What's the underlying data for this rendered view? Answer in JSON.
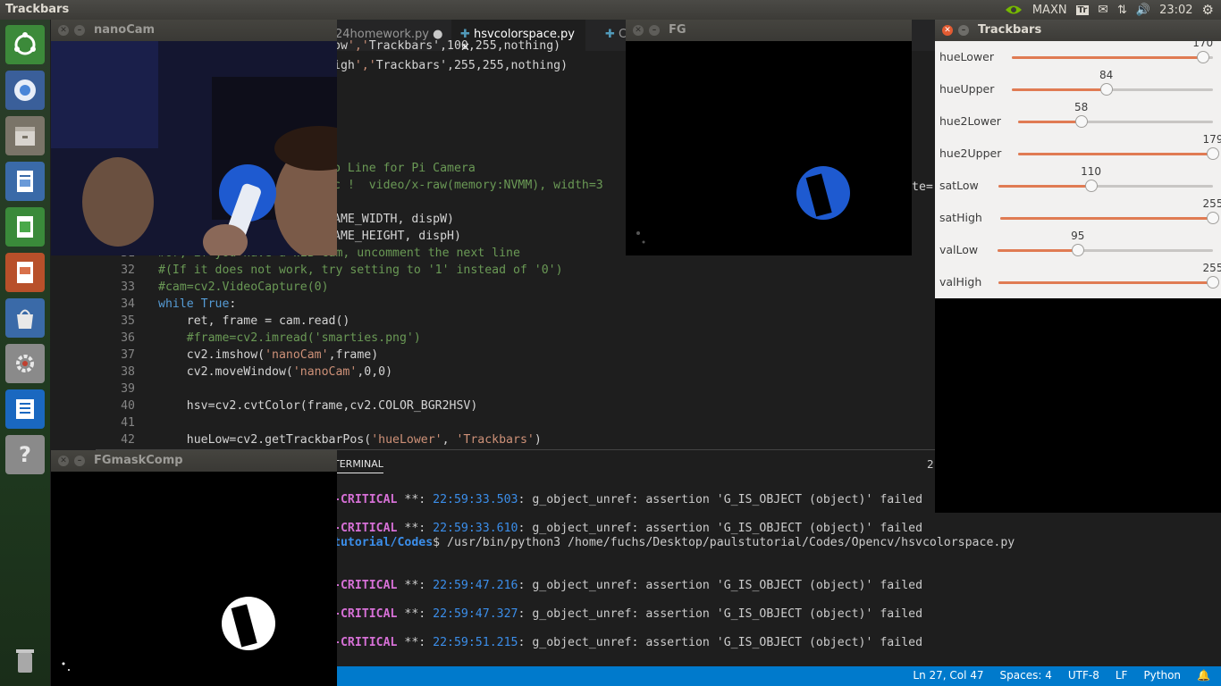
{
  "topbar": {
    "title": "Trackbars",
    "mode": "MAXN",
    "clock": "23:02"
  },
  "editor": {
    "tabs": [
      {
        "label": "24homework.py"
      },
      {
        "label": "hsvcolorspace.py"
      },
      {
        "label": "C"
      }
    ],
    "lines": [
      {
        "n": "",
        "text": "ow','Trackbars',100,255,nothing)"
      },
      {
        "n": "",
        "text": "igh','Trackbars',255,255,nothing)"
      },
      {
        "n": "",
        "text": "o Line for Pi Camera"
      },
      {
        "n": "",
        "text": "c !  video/x-raw(memory:NVMM), width=3"
      },
      {
        "n": "",
        "text": "AME_WIDTH, dispW)"
      },
      {
        "n": "",
        "text": "AME_HEIGHT, dispH)"
      },
      {
        "n": "31",
        "text": "#or, if you have a WEB cam, uncomment the next line"
      },
      {
        "n": "32",
        "text": "#(If it does not work, try setting to '1' instead of '0')"
      },
      {
        "n": "33",
        "text": "#cam=cv2.VideoCapture(0)"
      },
      {
        "n": "34",
        "text": "while True:"
      },
      {
        "n": "35",
        "text": "    ret, frame = cam.read()"
      },
      {
        "n": "36",
        "text": "    #frame=cv2.imread('smarties.png')"
      },
      {
        "n": "37",
        "text": "    cv2.imshow('nanoCam',frame)"
      },
      {
        "n": "38",
        "text": "    cv2.moveWindow('nanoCam',0,0)"
      },
      {
        "n": "39",
        "text": ""
      },
      {
        "n": "40",
        "text": "    hsv=cv2.cvtColor(frame,cv2.COLOR_BGR2HSV)"
      },
      {
        "n": "41",
        "text": ""
      },
      {
        "n": "42",
        "text": "    hueLow=cv2.getTrackbarPos('hueLower', 'Trackbars')"
      }
    ],
    "fg_tail": "te="
  },
  "terminal": {
    "tab": "TERMINAL",
    "lines": [
      {
        "crit": "-CRITICAL",
        "stars": " **: ",
        "time": "22:59:33.503",
        "msg": ": g_object_unref: assertion 'G_IS_OBJECT (object)' failed"
      },
      {
        "crit": "-CRITICAL",
        "stars": " **: ",
        "time": "22:59:33.610",
        "msg": ": g_object_unref: assertion 'G_IS_OBJECT (object)' failed"
      },
      {
        "path": "tutorial/Codes",
        "cmd": "$ /usr/bin/python3 /home/fuchs/Desktop/paulstutorial/Codes/Opencv/hsvcolorspace.py"
      },
      {
        "crit": "-CRITICAL",
        "stars": " **: ",
        "time": "22:59:47.216",
        "msg": ": g_object_unref: assertion 'G_IS_OBJECT (object)' failed"
      },
      {
        "crit": "-CRITICAL",
        "stars": " **: ",
        "time": "22:59:47.327",
        "msg": ": g_object_unref: assertion 'G_IS_OBJECT (object)' failed"
      },
      {
        "crit": "-CRITICAL",
        "stars": " **: ",
        "time": "22:59:51.215",
        "msg": ": g_object_unref: assertion 'G_IS_OBJECT (object)' failed"
      }
    ],
    "panel_num": "2"
  },
  "status": {
    "position": "Ln 27, Col 47",
    "spaces": "Spaces: 4",
    "encoding": "UTF-8",
    "eol": "LF",
    "language": "Python"
  },
  "windows": {
    "nanocam": {
      "title": "nanoCam"
    },
    "fg": {
      "title": "FG"
    },
    "fgmask": {
      "title": "FGmaskComp"
    },
    "trackbars": {
      "title": "Trackbars"
    }
  },
  "trackbars": [
    {
      "label": "hueLower",
      "value": "170",
      "max": 179
    },
    {
      "label": "hueUpper",
      "value": "84",
      "max": 179
    },
    {
      "label": "hue2Lower",
      "value": "58",
      "max": 179
    },
    {
      "label": "hue2Upper",
      "value": "179",
      "max": 179
    },
    {
      "label": "satLow",
      "value": "110",
      "max": 255
    },
    {
      "label": "satHigh",
      "value": "255",
      "max": 255
    },
    {
      "label": "valLow",
      "value": "95",
      "max": 255
    },
    {
      "label": "valHigh",
      "value": "255",
      "max": 255
    }
  ],
  "colors": {
    "accent": "#007acc",
    "slider": "#e07b53",
    "critical": "#d670d6",
    "timestamp": "#3b8eea"
  }
}
